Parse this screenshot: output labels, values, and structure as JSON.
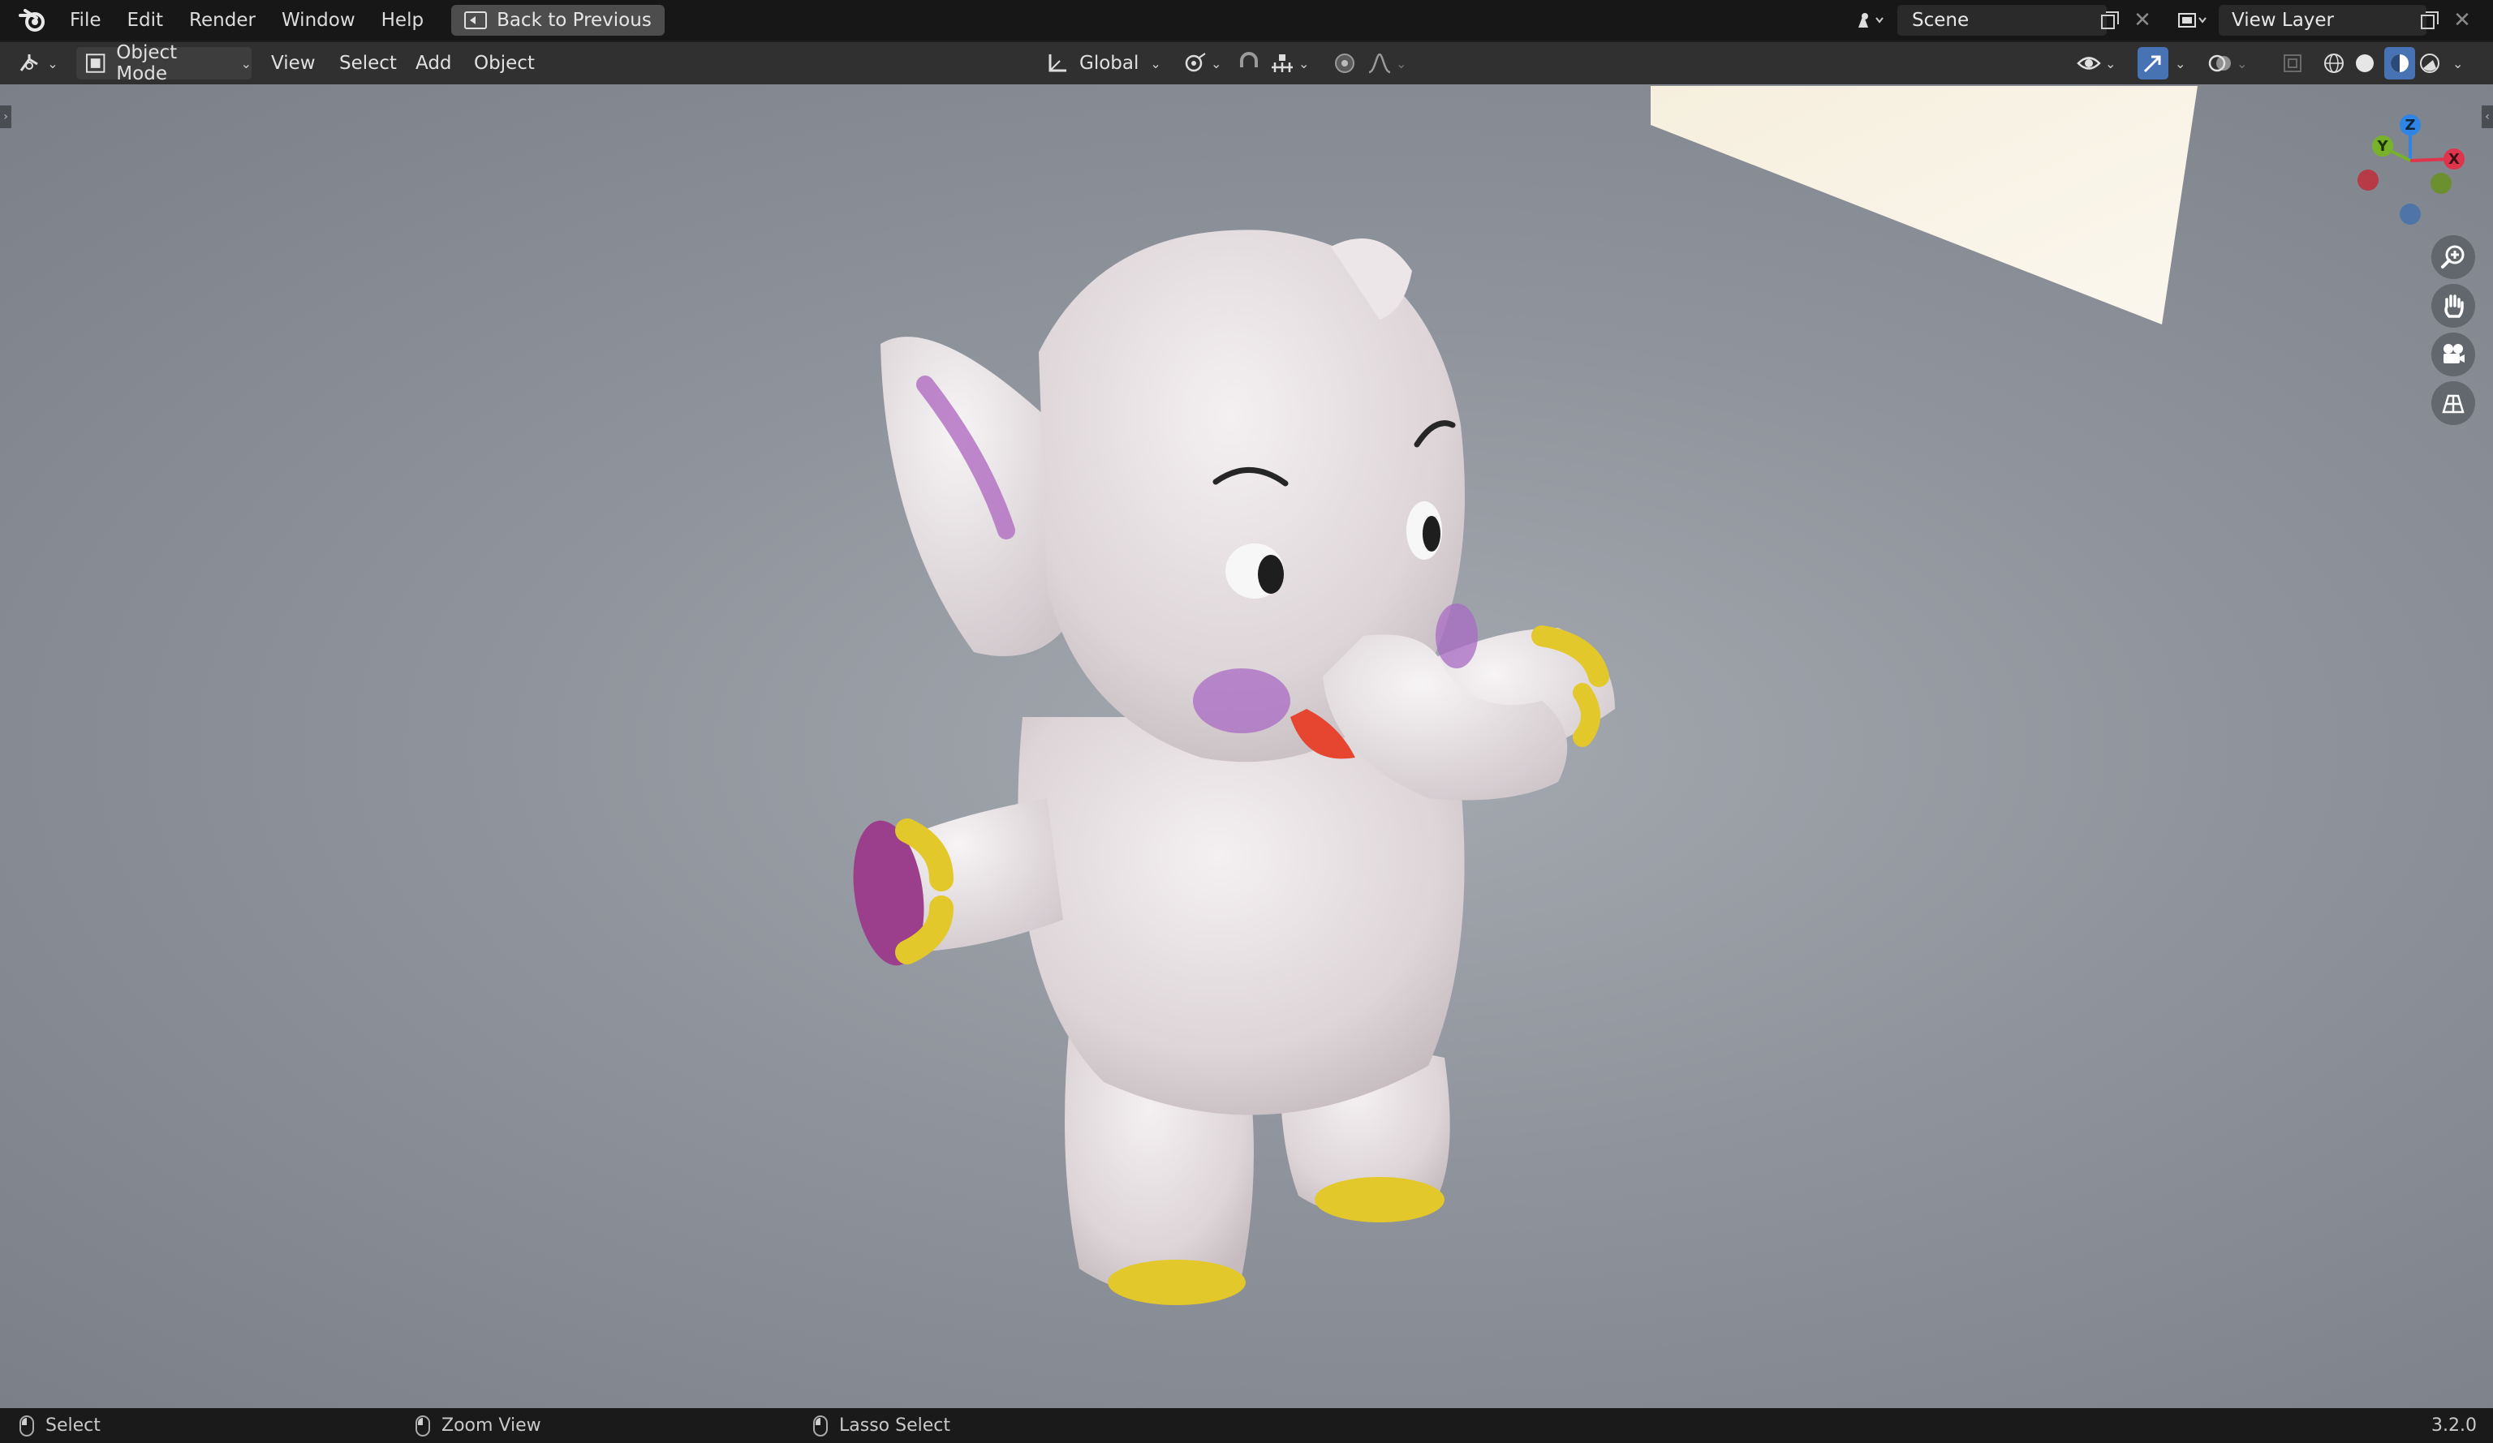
{
  "topbar": {
    "menu": [
      "File",
      "Edit",
      "Render",
      "Window",
      "Help"
    ],
    "back_button": "Back to Previous",
    "scene": "Scene",
    "view_layer": "View Layer"
  },
  "header": {
    "editor_type_icon": "editor-type-icon",
    "mode": "Object Mode",
    "menus": [
      "View",
      "Select",
      "Add",
      "Object"
    ],
    "transform_orientation": "Global",
    "shading": "solid-shading-active"
  },
  "gizmo": {
    "axes": {
      "x": "X",
      "y": "Y",
      "z": "Z"
    },
    "colors": {
      "x": "#e0344d",
      "y": "#78b22a",
      "z": "#2f85e6",
      "neg_x": "#b73a47",
      "neg_y": "#6c8f2f",
      "neg_z": "#4f75a8"
    }
  },
  "nav_buttons": [
    "zoom-icon",
    "pan-hand-icon",
    "camera-icon",
    "ortho-grid-icon"
  ],
  "statusbar": {
    "left": "Select",
    "middle": "Zoom View",
    "right": "Lasso Select",
    "version": "3.2.0"
  },
  "colors": {
    "topbar": "#171717",
    "header": "#303030",
    "viewport": "#8f949c",
    "accent": "#4772b3"
  }
}
